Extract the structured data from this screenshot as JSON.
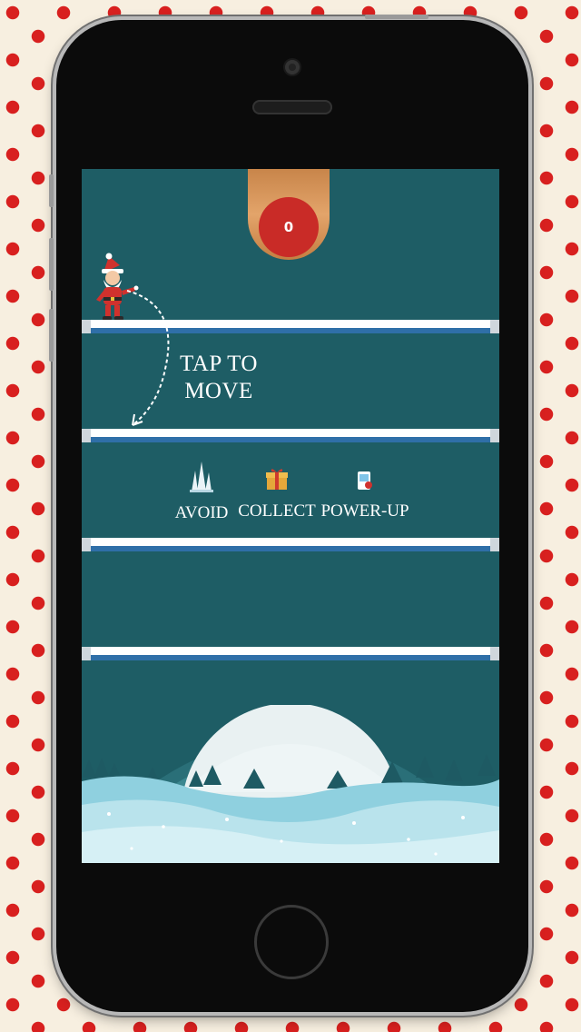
{
  "score": {
    "value": "0"
  },
  "tutorial": {
    "tap_line1": "TAP TO",
    "tap_line2": "MOVE"
  },
  "legend": {
    "avoid_label": "AVOID",
    "collect_label": "COLLECT",
    "powerup_label": "POWER-UP"
  },
  "icons": {
    "spikes": "spikes-icon",
    "gift": "gift-icon",
    "powerup": "powerup-icon",
    "character": "santa-icon"
  },
  "colors": {
    "screen_bg": "#1e5d65",
    "score_circle": "#c92b27",
    "pattern_red": "#d8201f",
    "pattern_bg": "#f7efe0"
  }
}
